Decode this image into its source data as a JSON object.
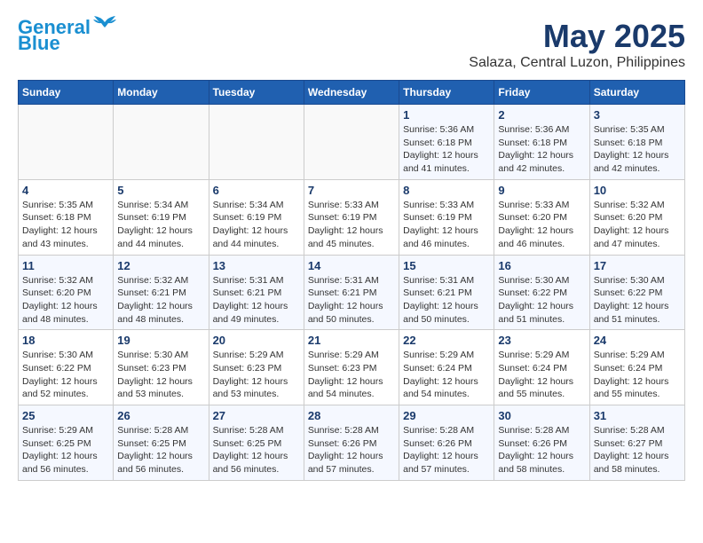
{
  "logo": {
    "line1": "General",
    "line2": "Blue"
  },
  "title": "May 2025",
  "subtitle": "Salaza, Central Luzon, Philippines",
  "days_header": [
    "Sunday",
    "Monday",
    "Tuesday",
    "Wednesday",
    "Thursday",
    "Friday",
    "Saturday"
  ],
  "weeks": [
    [
      {
        "day": "",
        "info": ""
      },
      {
        "day": "",
        "info": ""
      },
      {
        "day": "",
        "info": ""
      },
      {
        "day": "",
        "info": ""
      },
      {
        "day": "1",
        "info": "Sunrise: 5:36 AM\nSunset: 6:18 PM\nDaylight: 12 hours\nand 41 minutes."
      },
      {
        "day": "2",
        "info": "Sunrise: 5:36 AM\nSunset: 6:18 PM\nDaylight: 12 hours\nand 42 minutes."
      },
      {
        "day": "3",
        "info": "Sunrise: 5:35 AM\nSunset: 6:18 PM\nDaylight: 12 hours\nand 42 minutes."
      }
    ],
    [
      {
        "day": "4",
        "info": "Sunrise: 5:35 AM\nSunset: 6:18 PM\nDaylight: 12 hours\nand 43 minutes."
      },
      {
        "day": "5",
        "info": "Sunrise: 5:34 AM\nSunset: 6:19 PM\nDaylight: 12 hours\nand 44 minutes."
      },
      {
        "day": "6",
        "info": "Sunrise: 5:34 AM\nSunset: 6:19 PM\nDaylight: 12 hours\nand 44 minutes."
      },
      {
        "day": "7",
        "info": "Sunrise: 5:33 AM\nSunset: 6:19 PM\nDaylight: 12 hours\nand 45 minutes."
      },
      {
        "day": "8",
        "info": "Sunrise: 5:33 AM\nSunset: 6:19 PM\nDaylight: 12 hours\nand 46 minutes."
      },
      {
        "day": "9",
        "info": "Sunrise: 5:33 AM\nSunset: 6:20 PM\nDaylight: 12 hours\nand 46 minutes."
      },
      {
        "day": "10",
        "info": "Sunrise: 5:32 AM\nSunset: 6:20 PM\nDaylight: 12 hours\nand 47 minutes."
      }
    ],
    [
      {
        "day": "11",
        "info": "Sunrise: 5:32 AM\nSunset: 6:20 PM\nDaylight: 12 hours\nand 48 minutes."
      },
      {
        "day": "12",
        "info": "Sunrise: 5:32 AM\nSunset: 6:21 PM\nDaylight: 12 hours\nand 48 minutes."
      },
      {
        "day": "13",
        "info": "Sunrise: 5:31 AM\nSunset: 6:21 PM\nDaylight: 12 hours\nand 49 minutes."
      },
      {
        "day": "14",
        "info": "Sunrise: 5:31 AM\nSunset: 6:21 PM\nDaylight: 12 hours\nand 50 minutes."
      },
      {
        "day": "15",
        "info": "Sunrise: 5:31 AM\nSunset: 6:21 PM\nDaylight: 12 hours\nand 50 minutes."
      },
      {
        "day": "16",
        "info": "Sunrise: 5:30 AM\nSunset: 6:22 PM\nDaylight: 12 hours\nand 51 minutes."
      },
      {
        "day": "17",
        "info": "Sunrise: 5:30 AM\nSunset: 6:22 PM\nDaylight: 12 hours\nand 51 minutes."
      }
    ],
    [
      {
        "day": "18",
        "info": "Sunrise: 5:30 AM\nSunset: 6:22 PM\nDaylight: 12 hours\nand 52 minutes."
      },
      {
        "day": "19",
        "info": "Sunrise: 5:30 AM\nSunset: 6:23 PM\nDaylight: 12 hours\nand 53 minutes."
      },
      {
        "day": "20",
        "info": "Sunrise: 5:29 AM\nSunset: 6:23 PM\nDaylight: 12 hours\nand 53 minutes."
      },
      {
        "day": "21",
        "info": "Sunrise: 5:29 AM\nSunset: 6:23 PM\nDaylight: 12 hours\nand 54 minutes."
      },
      {
        "day": "22",
        "info": "Sunrise: 5:29 AM\nSunset: 6:24 PM\nDaylight: 12 hours\nand 54 minutes."
      },
      {
        "day": "23",
        "info": "Sunrise: 5:29 AM\nSunset: 6:24 PM\nDaylight: 12 hours\nand 55 minutes."
      },
      {
        "day": "24",
        "info": "Sunrise: 5:29 AM\nSunset: 6:24 PM\nDaylight: 12 hours\nand 55 minutes."
      }
    ],
    [
      {
        "day": "25",
        "info": "Sunrise: 5:29 AM\nSunset: 6:25 PM\nDaylight: 12 hours\nand 56 minutes."
      },
      {
        "day": "26",
        "info": "Sunrise: 5:28 AM\nSunset: 6:25 PM\nDaylight: 12 hours\nand 56 minutes."
      },
      {
        "day": "27",
        "info": "Sunrise: 5:28 AM\nSunset: 6:25 PM\nDaylight: 12 hours\nand 56 minutes."
      },
      {
        "day": "28",
        "info": "Sunrise: 5:28 AM\nSunset: 6:26 PM\nDaylight: 12 hours\nand 57 minutes."
      },
      {
        "day": "29",
        "info": "Sunrise: 5:28 AM\nSunset: 6:26 PM\nDaylight: 12 hours\nand 57 minutes."
      },
      {
        "day": "30",
        "info": "Sunrise: 5:28 AM\nSunset: 6:26 PM\nDaylight: 12 hours\nand 58 minutes."
      },
      {
        "day": "31",
        "info": "Sunrise: 5:28 AM\nSunset: 6:27 PM\nDaylight: 12 hours\nand 58 minutes."
      }
    ]
  ]
}
